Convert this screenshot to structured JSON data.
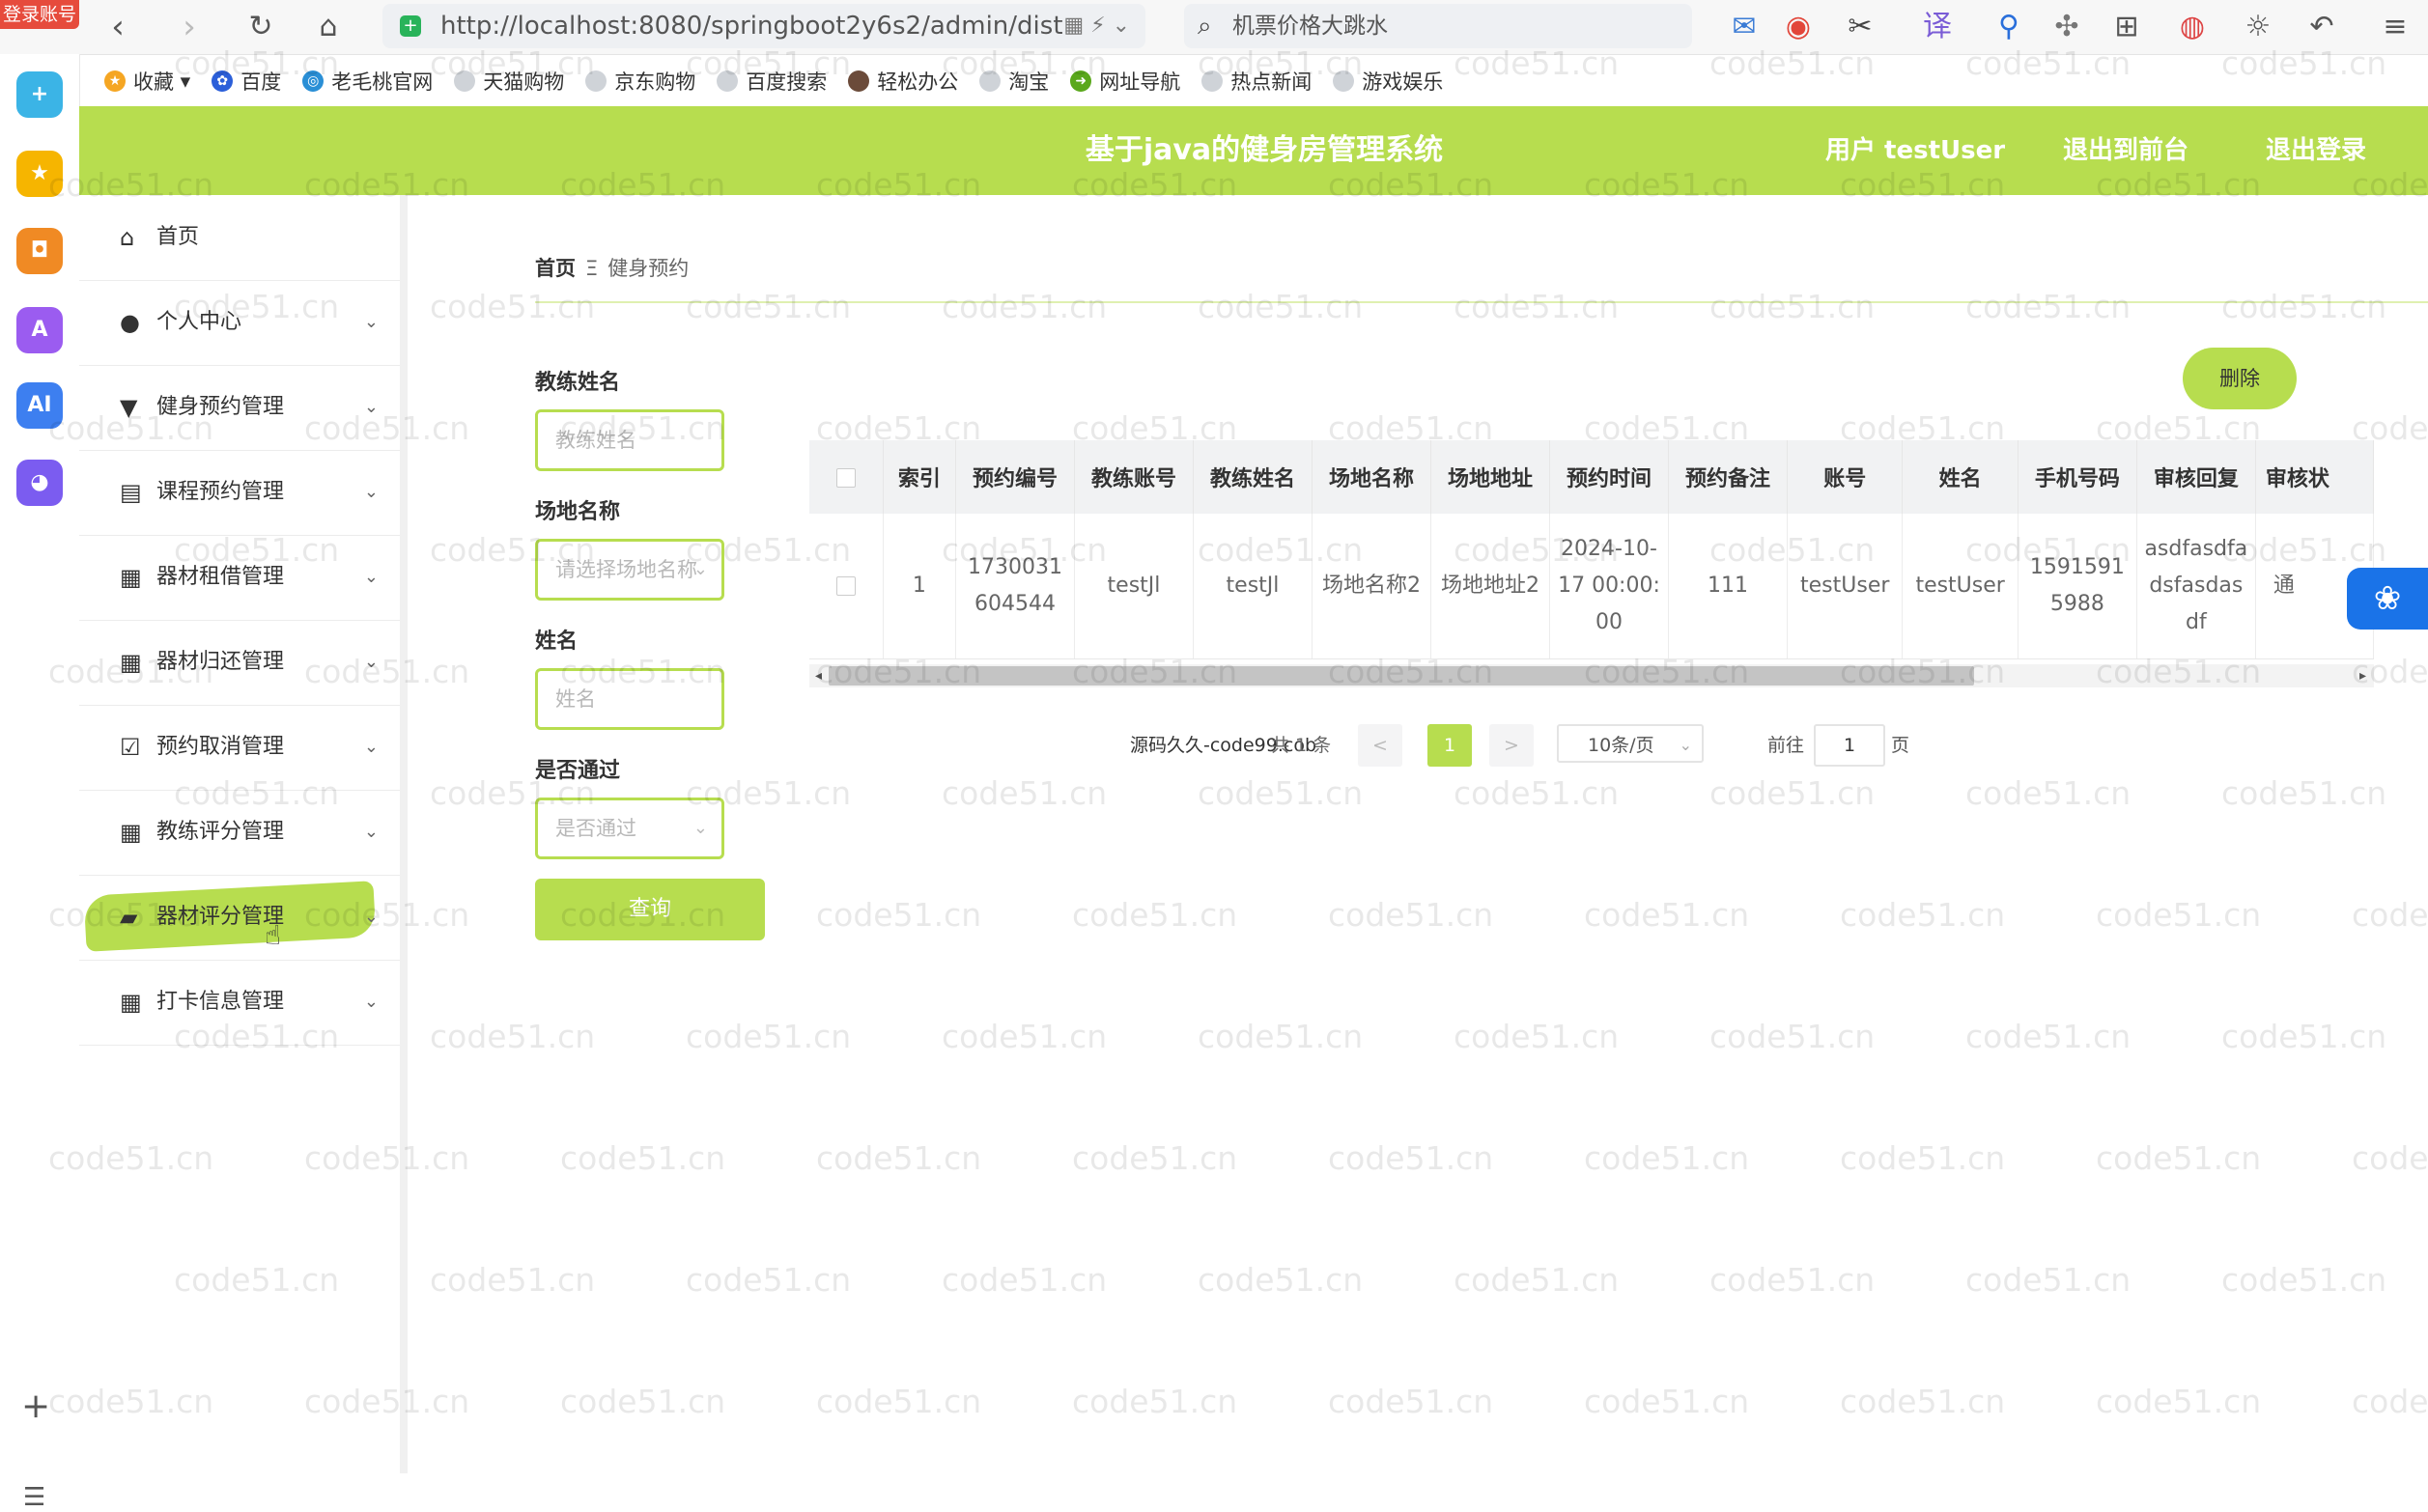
{
  "browser": {
    "login_badge": "登录账号",
    "url": "http://localhost:8080/springboot2y6s2/admin/dist",
    "search_text": "机票价格大跳水",
    "bookmarks": [
      "收藏",
      "百度",
      "老毛桃官网",
      "天猫购物",
      "京东购物",
      "百度搜索",
      "轻松办公",
      "淘宝",
      "网址导航",
      "热点新闻",
      "游戏娱乐"
    ]
  },
  "header": {
    "title": "基于java的健身房管理系统",
    "user": "用户 testUser",
    "front": "退出到前台",
    "logout": "退出登录"
  },
  "sidebar": {
    "items": [
      {
        "label": "首页",
        "icon": "home-icon"
      },
      {
        "label": "个人中心",
        "icon": "user-icon"
      },
      {
        "label": "健身预约管理",
        "icon": "stamp-icon"
      },
      {
        "label": "课程预约管理",
        "icon": "clipboard-icon"
      },
      {
        "label": "器材租借管理",
        "icon": "grid-icon"
      },
      {
        "label": "器材归还管理",
        "icon": "grid-icon"
      },
      {
        "label": "预约取消管理",
        "icon": "check-clipboard-icon"
      },
      {
        "label": "教练评分管理",
        "icon": "grid-icon"
      },
      {
        "label": "器材评分管理",
        "icon": "briefcase-icon"
      },
      {
        "label": "打卡信息管理",
        "icon": "grid-icon"
      }
    ],
    "active_index": 8
  },
  "breadcrumb": {
    "home": "首页",
    "sep": "Ξ",
    "current": "健身预约"
  },
  "filters": {
    "coach_name": {
      "label": "教练姓名",
      "placeholder": "教练姓名"
    },
    "venue_name": {
      "label": "场地名称",
      "placeholder": "请选择场地名称"
    },
    "name": {
      "label": "姓名",
      "placeholder": "姓名"
    },
    "approved": {
      "label": "是否通过",
      "placeholder": "是否通过"
    },
    "query_label": "查询"
  },
  "delete_label": "删除",
  "table": {
    "columns": [
      "索引",
      "预约编号",
      "教练账号",
      "教练姓名",
      "场地名称",
      "场地地址",
      "预约时间",
      "预约备注",
      "账号",
      "姓名",
      "手机号码",
      "审核回复",
      "审核状"
    ],
    "rows": [
      [
        "1",
        "1730031604544",
        "testJl",
        "testJl",
        "场地名称2",
        "场地地址2",
        "2024-10-17 00:00:00",
        "111",
        "testUser",
        "testUser",
        "15915915988",
        "asdfasdfadsfasdasdf",
        "通"
      ]
    ]
  },
  "pagination": {
    "source": "源码久久-code99.cob",
    "total": "共 1 条",
    "prev": "<",
    "current": "1",
    "next": ">",
    "page_size": "10条/页",
    "goto": "前往",
    "goto_value": "1",
    "unit": "页"
  },
  "watermark": "code51.cn",
  "colors": {
    "accent": "#b7dd4f",
    "float": "#1a73e8"
  }
}
